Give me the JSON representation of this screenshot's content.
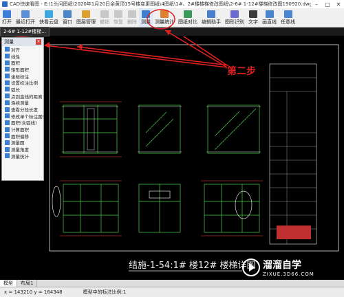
{
  "window": {
    "title": "CAD快速看图 - E:\\1头问图纸\\2020年1月20日余黄顶15号楼变更图纸\\4图纸\\1#、2#楼楼梯修改图纸\\2-6# 1-12#楼梯修改图190920.dwg"
  },
  "toolbar": {
    "items": [
      {
        "label": "打开",
        "color": "#3f7ed8",
        "state": ""
      },
      {
        "label": "最近打开",
        "color": "#5b8fd8",
        "state": ""
      },
      {
        "label": "快看云盘",
        "color": "#3ea6e0",
        "state": ""
      },
      {
        "label": "窗口",
        "color": "#4a86c8",
        "state": ""
      },
      {
        "label": "图层管理",
        "color": "#e0a030",
        "state": ""
      },
      {
        "label": "撤销",
        "color": "#c8c8c8",
        "state": "dis"
      },
      {
        "label": "恢复",
        "color": "#c8c8c8",
        "state": "dis"
      },
      {
        "label": "删除",
        "color": "#c8c8c8",
        "state": "dis"
      },
      {
        "label": "测量",
        "color": "#3c7fd0",
        "state": "active"
      },
      {
        "label": "测量统计",
        "color": "#e08030",
        "state": ""
      },
      {
        "label": "图纸对比",
        "color": "#3a9a5a",
        "state": ""
      },
      {
        "label": "编辑助手",
        "color": "#4a7ed0",
        "state": ""
      },
      {
        "label": "图形识别",
        "color": "#6a6ad0",
        "state": ""
      },
      {
        "label": "文字",
        "color": "#3a3a3a",
        "state": ""
      },
      {
        "label": "画直线",
        "color": "#4a86d0",
        "state": ""
      },
      {
        "label": "任意线",
        "color": "#4a86d0",
        "state": ""
      }
    ]
  },
  "doc_tab": {
    "label": "2-6# 1-12#楼梯..."
  },
  "panel": {
    "title": "测量",
    "items": [
      {
        "label": "对齐",
        "color": "#3c7fd0"
      },
      {
        "label": "线性",
        "color": "#3c7fd0"
      },
      {
        "label": "面积",
        "color": "#3c7fd0"
      },
      {
        "label": "矩形面积",
        "color": "#3c7fd0"
      },
      {
        "label": "坐标标注",
        "color": "#3c7fd0"
      },
      {
        "label": "设置标注比例",
        "color": "#3c7fd0"
      },
      {
        "label": "弧长",
        "color": "#3c7fd0"
      },
      {
        "label": "点到直线的距离",
        "color": "#3c7fd0"
      },
      {
        "label": "连续测量",
        "color": "#3c7fd0"
      },
      {
        "label": "查看分段长度",
        "color": "#3c7fd0"
      },
      {
        "label": "修改单个标注属性",
        "color": "#3c7fd0"
      },
      {
        "label": "面积(含弧线)",
        "color": "#3c7fd0"
      },
      {
        "label": "计算面积",
        "color": "#3c7fd0"
      },
      {
        "label": "面积偏移",
        "color": "#3c7fd0"
      },
      {
        "label": "测量圆",
        "color": "#3c7fd0"
      },
      {
        "label": "测量角度",
        "color": "#3c7fd0"
      },
      {
        "label": "测量统计",
        "color": "#3c7fd0"
      }
    ]
  },
  "annotation": {
    "step_label": "第二步",
    "color": "#e02020"
  },
  "drawing": {
    "title": "结施-1-54:1# 楼12# 楼梯详图"
  },
  "layout_tabs": [
    "模型",
    "布局1"
  ],
  "status": {
    "coords": "x = 143210  y = 164348",
    "scale": "模型中的标注比例:1"
  },
  "watermark": {
    "name": "溜溜自学",
    "url": "ZIXUE.3D66.COM"
  }
}
